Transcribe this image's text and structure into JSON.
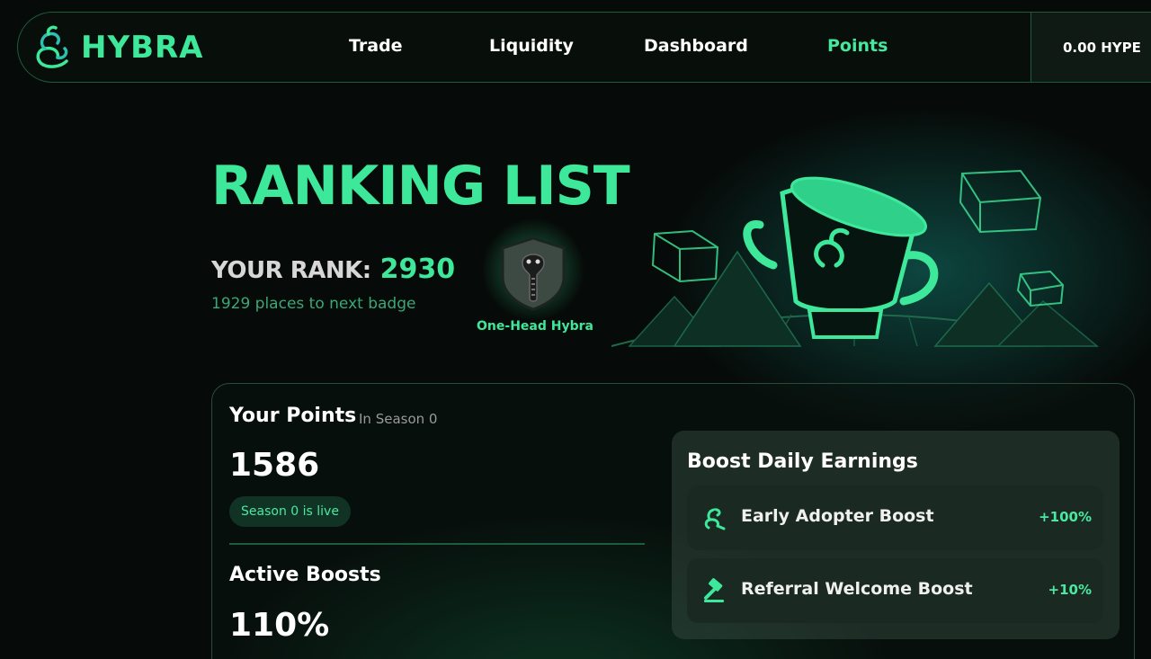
{
  "nav": {
    "logo_text": "HYBRA",
    "links": [
      {
        "label": "Trade"
      },
      {
        "label": "Liquidity"
      },
      {
        "label": "Dashboard"
      },
      {
        "label": "Points",
        "active": true
      }
    ],
    "balance": "0.00 HYPE"
  },
  "hero": {
    "title": "RANKING LIST",
    "rank_label": "YOUR RANK:",
    "rank_value": "2930",
    "next_badge_text": "1929 places to next badge",
    "badge_name": "One-Head Hybra",
    "badge_icon": "cobra-shield-icon",
    "illustration_icon": "trophy-cup-icon"
  },
  "points_card": {
    "title": "Your Points",
    "season_label": "In Season 0",
    "points_value": "1586",
    "season_status": "Season 0 is live",
    "active_boosts_title": "Active Boosts",
    "active_boosts_value": "110%"
  },
  "boost_panel": {
    "title": "Boost Daily Earnings",
    "items": [
      {
        "label": "Early Adopter Boost",
        "value": "+100%",
        "icon": "snake-icon"
      },
      {
        "label": "Referral Welcome Boost",
        "value": "+10%",
        "icon": "gavel-icon"
      }
    ]
  },
  "colors": {
    "accent": "#3ee89a",
    "background": "#060a08",
    "card_border": "#2a4a3a"
  }
}
